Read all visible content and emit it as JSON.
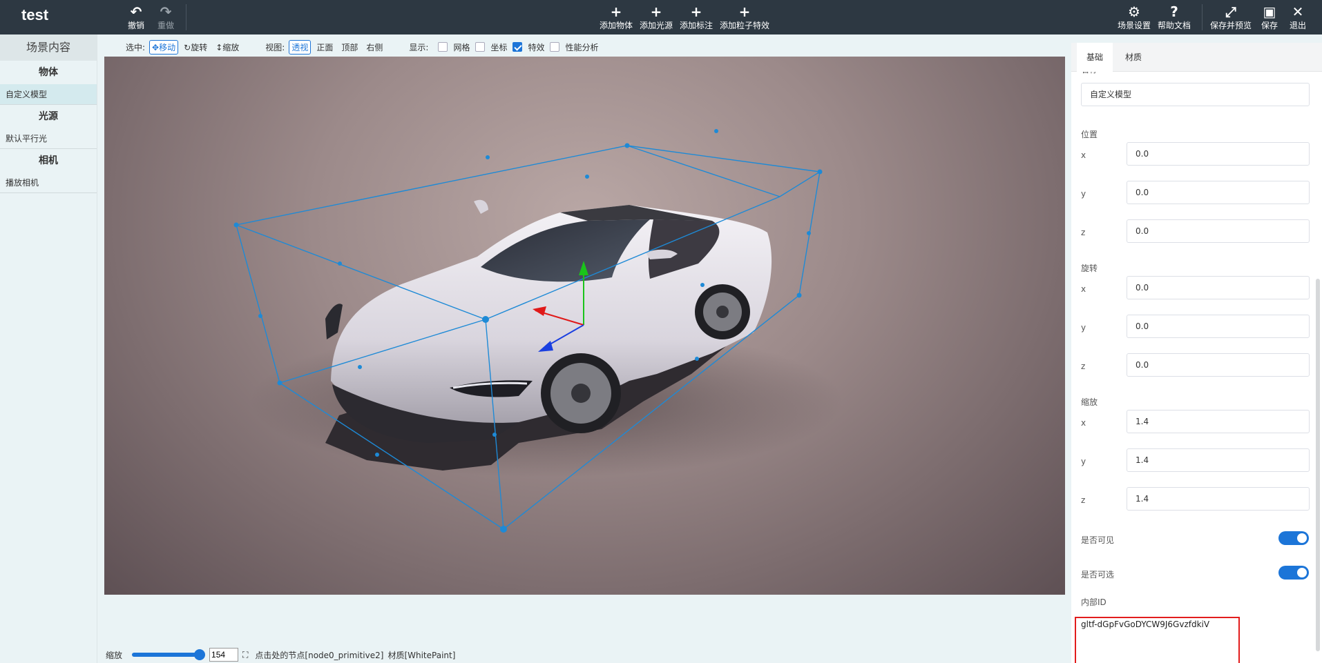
{
  "app": {
    "title": "test"
  },
  "toolbar": {
    "undo": "撤销",
    "redo": "重做",
    "add_object": "添加物体",
    "add_light": "添加光源",
    "add_annotation": "添加标注",
    "add_particle": "添加粒子特效",
    "scene_settings": "场景设置",
    "help_docs": "帮助文档",
    "save_preview": "保存并预览",
    "save": "保存",
    "exit": "退出"
  },
  "left_panel": {
    "header": "场景内容",
    "groups": [
      {
        "title": "物体",
        "items": [
          "自定义模型"
        ]
      },
      {
        "title": "光源",
        "items": [
          "默认平行光"
        ]
      },
      {
        "title": "相机",
        "items": [
          "播放相机"
        ]
      }
    ]
  },
  "viewport_toolbar": {
    "select_label": "选中:",
    "move": "移动",
    "rotate": "旋转",
    "scale": "缩放",
    "view_label": "视图:",
    "perspective": "透视",
    "front": "正面",
    "top": "顶部",
    "right": "右侧",
    "display_label": "显示:",
    "grid": "网格",
    "axes": "坐标",
    "effects": "特效",
    "perf": "性能分析",
    "grid_checked": false,
    "axes_checked": false,
    "effects_checked": true,
    "perf_checked": false
  },
  "status": {
    "zoom_label": "缩放",
    "zoom_value": "154",
    "node_text": "点击处的节点[node0_primitive2]",
    "material_text": "材质[WhitePaint]"
  },
  "properties": {
    "tabs": [
      "基础",
      "材质"
    ],
    "name_label": "名称",
    "name_value": "自定义模型",
    "position_label": "位置",
    "rotation_label": "旋转",
    "scale_label": "缩放",
    "axes": [
      "x",
      "y",
      "z"
    ],
    "position": [
      "0.0",
      "0.0",
      "0.0"
    ],
    "rotation": [
      "0.0",
      "0.0",
      "0.0"
    ],
    "scale": [
      "1.4",
      "1.4",
      "1.4"
    ],
    "visible_label": "是否可见",
    "selectable_label": "是否可选",
    "visible": true,
    "selectable": true,
    "internal_id_label": "内部ID",
    "internal_id": "gltf-dGpFvGoDYCW9J6GvzfdkiV"
  },
  "colors": {
    "topbar": "#2d3842",
    "accent": "#1c75d8",
    "gizmo": "#1e8ad6",
    "highlight_box": "#e21c1c"
  }
}
